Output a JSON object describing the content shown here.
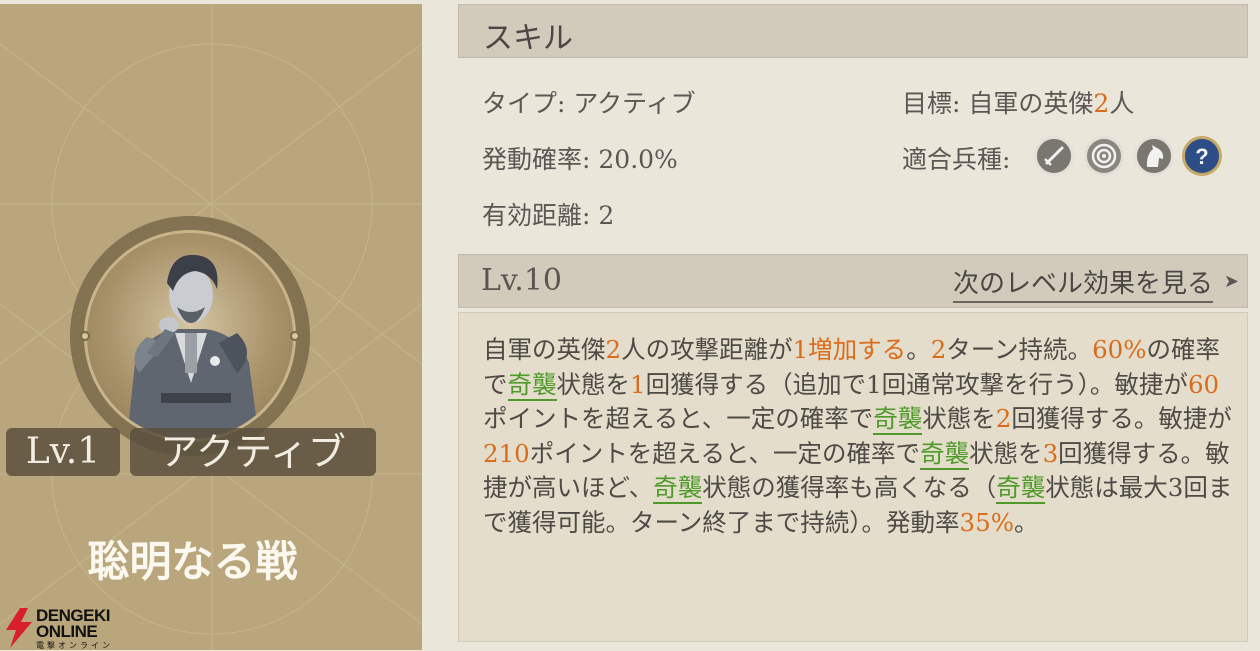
{
  "card": {
    "level_badge": "Lv.1",
    "type_badge": "アクティブ",
    "skill_name": "聡明なる戦"
  },
  "watermark": {
    "line1": "DENGEKI",
    "line2": "ONLINE",
    "line3": "電撃オンライン"
  },
  "skill": {
    "header": "スキル",
    "type_label": "タイプ:",
    "type_value": "アクティブ",
    "rate_label": "発動確率:",
    "rate_value": "20.0%",
    "range_label": "有効距離:",
    "range_value": "2",
    "target_label": "目標:",
    "target_prefix": "自軍の英傑",
    "target_count": "2",
    "target_suffix": "人",
    "units_label": "適合兵種:",
    "unit_icons": [
      "sword-icon",
      "bow-target-icon",
      "cavalry-horse-icon",
      "unknown-question-icon"
    ]
  },
  "level": {
    "label": "Lv.10",
    "next_link": "次のレベル効果を見る",
    "arrow": "➤"
  },
  "description": {
    "segments": [
      {
        "t": "自軍の英傑",
        "s": "plain"
      },
      {
        "t": "2",
        "s": "hl"
      },
      {
        "t": "人の攻撃距離が",
        "s": "plain"
      },
      {
        "t": "1増加する",
        "s": "hl"
      },
      {
        "t": "。",
        "s": "plain"
      },
      {
        "t": "2",
        "s": "hl"
      },
      {
        "t": "ターン持続。",
        "s": "plain"
      },
      {
        "t": "60%",
        "s": "hl"
      },
      {
        "t": "の確率で",
        "s": "plain"
      },
      {
        "t": "奇襲",
        "s": "kw"
      },
      {
        "t": "状態を",
        "s": "plain"
      },
      {
        "t": "1",
        "s": "hl"
      },
      {
        "t": "回獲得する（追加で1回通常攻撃を行う）。敏捷が",
        "s": "plain"
      },
      {
        "t": "60",
        "s": "hl"
      },
      {
        "t": "ポイントを超えると、一定の確率で",
        "s": "plain"
      },
      {
        "t": "奇襲",
        "s": "kw"
      },
      {
        "t": "状態を",
        "s": "plain"
      },
      {
        "t": "2",
        "s": "hl"
      },
      {
        "t": "回獲得する。敏捷が",
        "s": "plain"
      },
      {
        "t": "210",
        "s": "hl"
      },
      {
        "t": "ポイントを超えると、一定の確率で",
        "s": "plain"
      },
      {
        "t": "奇襲",
        "s": "kw"
      },
      {
        "t": "状態を",
        "s": "plain"
      },
      {
        "t": "3",
        "s": "hl"
      },
      {
        "t": "回獲得する。敏捷が高いほど、",
        "s": "plain"
      },
      {
        "t": "奇襲",
        "s": "kw"
      },
      {
        "t": "状態の獲得率も高くなる（",
        "s": "plain"
      },
      {
        "t": "奇襲",
        "s": "kw"
      },
      {
        "t": "状態は最大3回まで獲得可能。ターン終了まで持続）。発動率",
        "s": "plain"
      },
      {
        "t": "35%",
        "s": "hl"
      },
      {
        "t": "。",
        "s": "plain"
      }
    ]
  },
  "colors": {
    "highlight": "#d96d1c",
    "keyword": "#4f9a2a",
    "card_bg": "#b9a67c",
    "panel_bg": "#ebe6da"
  }
}
